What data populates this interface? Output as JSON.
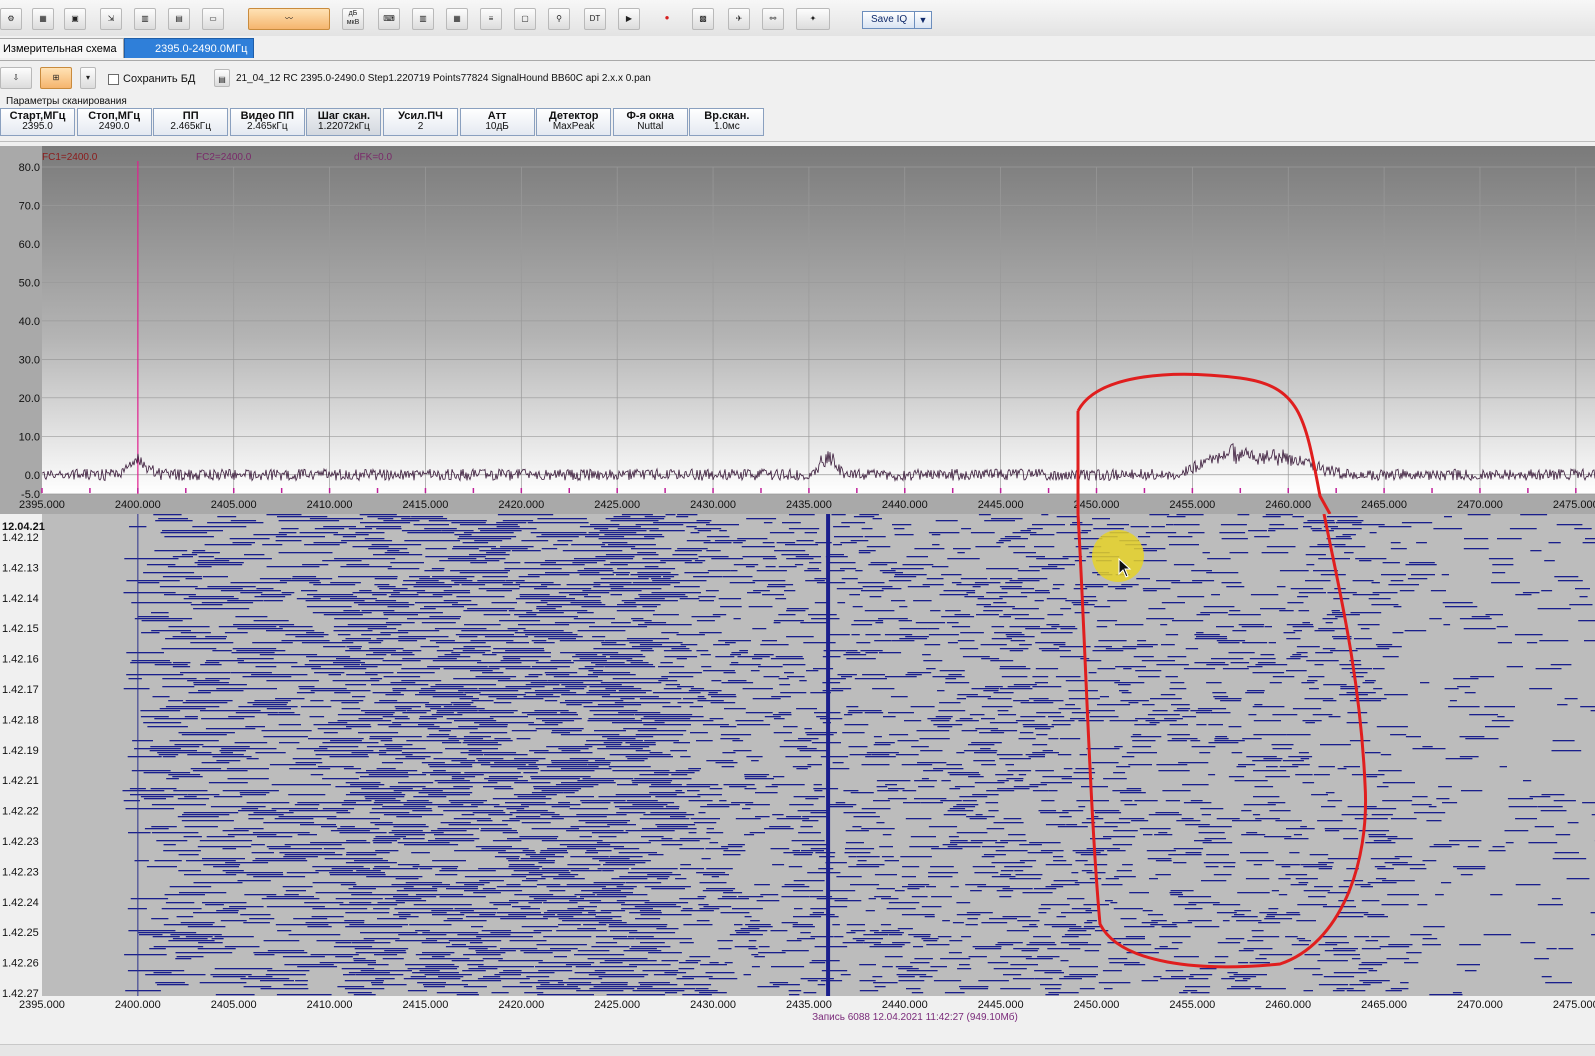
{
  "toolbar": {
    "icons": [
      "gear-icon",
      "grid-icon",
      "folders-icon",
      "import-icon",
      "histogram-icon",
      "bar-chart-icon",
      "monitor-icon",
      "spectrum-mode-icon",
      "db-mkv-icon",
      "keyboard-icon",
      "columns-icon",
      "table-icon",
      "layers-icon",
      "disabled-icon",
      "antenna-icon",
      "dt-icon",
      "play-icon",
      "record-icon",
      "waveform-icon",
      "broadcast-icon",
      "satellite-search-icon",
      "satellite-icon"
    ],
    "db_mkv_label": "дБ мкВ",
    "dt_label": "DT",
    "saveiq_label": "Save IQ"
  },
  "tabs": [
    {
      "label": "Измерительная схема",
      "selected": false
    },
    {
      "label": "2395.0-2490.0МГц",
      "selected": true
    }
  ],
  "bar2": {
    "save_db_label": "Сохранить БД",
    "save_db_checked": false,
    "file_name": "21_04_12 RC 2395.0-2490.0 Step1.220719 Points77824 SignalHound BB60C api 2.x.x 0.pan"
  },
  "scan_params": {
    "title": "Параметры сканирования",
    "buttons": [
      {
        "label": "Старт,МГц",
        "value": "2395.0"
      },
      {
        "label": "Стоп,МГц",
        "value": "2490.0"
      },
      {
        "label": "ПП",
        "value": "2.465кГц"
      },
      {
        "label": "Видео ПП",
        "value": "2.465кГц"
      },
      {
        "label": "Шаг скан.",
        "value": "1.22072кГц"
      },
      {
        "label": "Усил.ПЧ",
        "value": "2"
      },
      {
        "label": "Атт",
        "value": "10дБ"
      },
      {
        "label": "Детектор",
        "value": "MaxPeak"
      },
      {
        "label": "Ф-я окна",
        "value": "Nuttal"
      },
      {
        "label": "Вр.скан.",
        "value": "1.0мс"
      }
    ]
  },
  "markers": {
    "fc1": "FC1=2400.0",
    "fc2": "FC2=2400.0",
    "dfk": "dFK=0.0"
  },
  "chart_data": {
    "type": "line",
    "title": "",
    "xlabel": "",
    "ylabel": "",
    "xlim": [
      2395.0,
      2476.0
    ],
    "ylim": [
      -5.0,
      80.0
    ],
    "yticks": [
      80.0,
      70.0,
      60.0,
      50.0,
      40.0,
      30.0,
      20.0,
      10.0,
      0.0,
      -5.0
    ],
    "xticks": [
      2395.0,
      2400.0,
      2405.0,
      2410.0,
      2415.0,
      2420.0,
      2425.0,
      2430.0,
      2435.0,
      2440.0,
      2445.0,
      2450.0,
      2455.0,
      2460.0,
      2465.0,
      2470.0,
      2475.0
    ],
    "marker_freq": 2400.0,
    "noise_floor": 0.0,
    "peaks": [
      {
        "x": 2400.0,
        "y": 4.5
      },
      {
        "x": 2436.0,
        "y": 5.0
      },
      {
        "x": 2457.0,
        "y": 6.5
      },
      {
        "x": 2460.0,
        "y": 5.0
      }
    ],
    "grid": true
  },
  "waterfall": {
    "date_label": "12.04.21",
    "time_labels": [
      "1.42.12",
      "1.42.13",
      "1.42.14",
      "1.42.15",
      "1.42.16",
      "1.42.17",
      "1.42.18",
      "1.42.19",
      "1.42.21",
      "1.42.22",
      "1.42.23",
      "1.42.23",
      "1.42.24",
      "1.42.25",
      "1.42.26",
      "1.42.27"
    ],
    "xticks": [
      2395.0,
      2400.0,
      2405.0,
      2410.0,
      2415.0,
      2420.0,
      2425.0,
      2430.0,
      2435.0,
      2440.0,
      2445.0,
      2450.0,
      2455.0,
      2460.0,
      2465.0,
      2470.0,
      2475.0
    ],
    "strong_line_freq": 2436.0
  },
  "status": {
    "record": "Запись 6088 12.04.2021 11:42:27 (949.10Мб)"
  },
  "colors": {
    "trace": "#3a1a3a",
    "marker": "#e0208f",
    "waterfall_bg": "#bcbcbc",
    "waterfall_signal": "#1a1f8c",
    "annotation": "#e01e1e"
  }
}
